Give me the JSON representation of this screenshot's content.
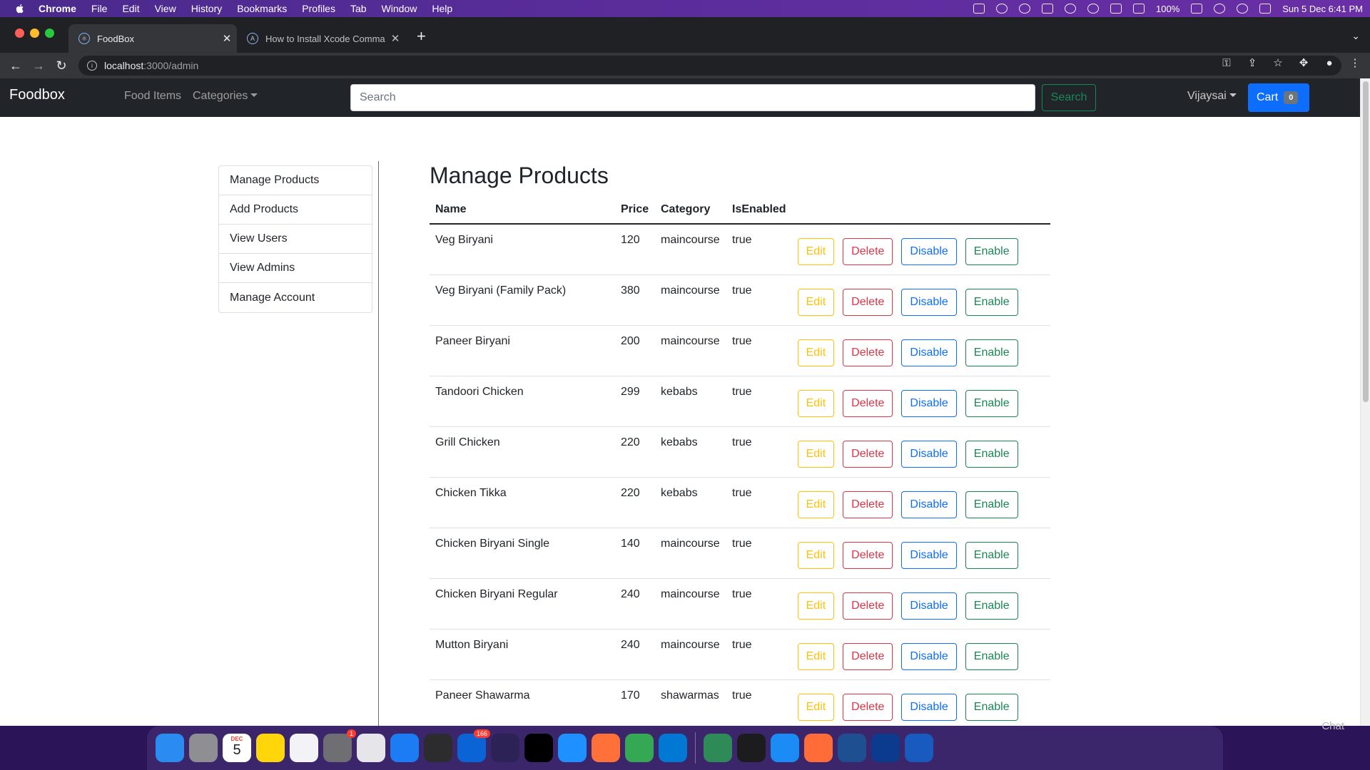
{
  "menubar": {
    "app": "Chrome",
    "items": [
      "File",
      "Edit",
      "View",
      "History",
      "Bookmarks",
      "Profiles",
      "Tab",
      "Window",
      "Help"
    ],
    "battery": "100%",
    "datetime": "Sun 5 Dec  6:41 PM"
  },
  "browser": {
    "tabs": [
      {
        "title": "FoodBox",
        "active": true
      },
      {
        "title": "How to Install Xcode Command",
        "active": false
      }
    ],
    "url_host": "localhost",
    "url_path": ":3000/admin"
  },
  "navbar": {
    "brand": "Foodbox",
    "links": [
      "Food Items",
      "Categories"
    ],
    "search_placeholder": "Search",
    "search_button": "Search",
    "user": "Vijaysai",
    "cart_label": "Cart",
    "cart_count": "0"
  },
  "sidebar": {
    "items": [
      "Manage Products",
      "Add Products",
      "View Users",
      "View Admins",
      "Manage Account"
    ]
  },
  "main": {
    "title": "Manage Products",
    "columns": [
      "Name",
      "Price",
      "Category",
      "IsEnabled"
    ],
    "rows": [
      {
        "name": "Veg Biryani",
        "price": "120",
        "category": "maincourse",
        "enabled": "true"
      },
      {
        "name": "Veg Biryani (Family Pack)",
        "price": "380",
        "category": "maincourse",
        "enabled": "true"
      },
      {
        "name": "Paneer Biryani",
        "price": "200",
        "category": "maincourse",
        "enabled": "true"
      },
      {
        "name": "Tandoori Chicken",
        "price": "299",
        "category": "kebabs",
        "enabled": "true"
      },
      {
        "name": "Grill Chicken",
        "price": "220",
        "category": "kebabs",
        "enabled": "true"
      },
      {
        "name": "Chicken Tikka",
        "price": "220",
        "category": "kebabs",
        "enabled": "true"
      },
      {
        "name": "Chicken Biryani Single",
        "price": "140",
        "category": "maincourse",
        "enabled": "true"
      },
      {
        "name": "Chicken Biryani Regular",
        "price": "240",
        "category": "maincourse",
        "enabled": "true"
      },
      {
        "name": "Mutton Biryani",
        "price": "240",
        "category": "maincourse",
        "enabled": "true"
      },
      {
        "name": "Paneer Shawarma",
        "price": "170",
        "category": "shawarmas",
        "enabled": "true"
      }
    ],
    "actions": {
      "edit": "Edit",
      "delete": "Delete",
      "disable": "Disable",
      "enable": "Enable"
    }
  },
  "dock": {
    "icons": [
      {
        "name": "finder-icon",
        "color": "#2a8cf0"
      },
      {
        "name": "launchpad-icon",
        "color": "#8e8e93"
      },
      {
        "name": "calendar-icon",
        "color": "#ffffff"
      },
      {
        "name": "notes-icon",
        "color": "#ffd60a"
      },
      {
        "name": "reminders-icon",
        "color": "#f2f2f7"
      },
      {
        "name": "system-preferences-icon",
        "color": "#6e6e73"
      },
      {
        "name": "textedit-icon",
        "color": "#e5e5ea"
      },
      {
        "name": "xcode-icon",
        "color": "#1c7cf4"
      },
      {
        "name": "obs-icon",
        "color": "#2c2c2e"
      },
      {
        "name": "outlook-icon",
        "color": "#0a64d6"
      },
      {
        "name": "eclipse-icon",
        "color": "#2c2255"
      },
      {
        "name": "intellij-icon",
        "color": "#000000"
      },
      {
        "name": "safari-icon",
        "color": "#1e90ff"
      },
      {
        "name": "firefox-icon",
        "color": "#ff7139"
      },
      {
        "name": "chrome-icon",
        "color": "#34a853"
      },
      {
        "name": "vscode-icon",
        "color": "#0078d4"
      },
      {
        "name": "sourcetree-icon",
        "color": "#2e8b57"
      },
      {
        "name": "activity-monitor-icon",
        "color": "#1c1c1e"
      },
      {
        "name": "app-store-icon",
        "color": "#1b8cf5"
      },
      {
        "name": "postman-icon",
        "color": "#ff6c37"
      },
      {
        "name": "mysql-workbench-icon",
        "color": "#1d4f91"
      },
      {
        "name": "webex-icon",
        "color": "#0a3b8c"
      },
      {
        "name": "word-icon",
        "color": "#185abd"
      }
    ],
    "badges": {
      "system-preferences-icon": "1",
      "outlook-icon": "166"
    },
    "calendar_day": "5",
    "calendar_month": "DEC"
  },
  "chat_hint": "Chat"
}
